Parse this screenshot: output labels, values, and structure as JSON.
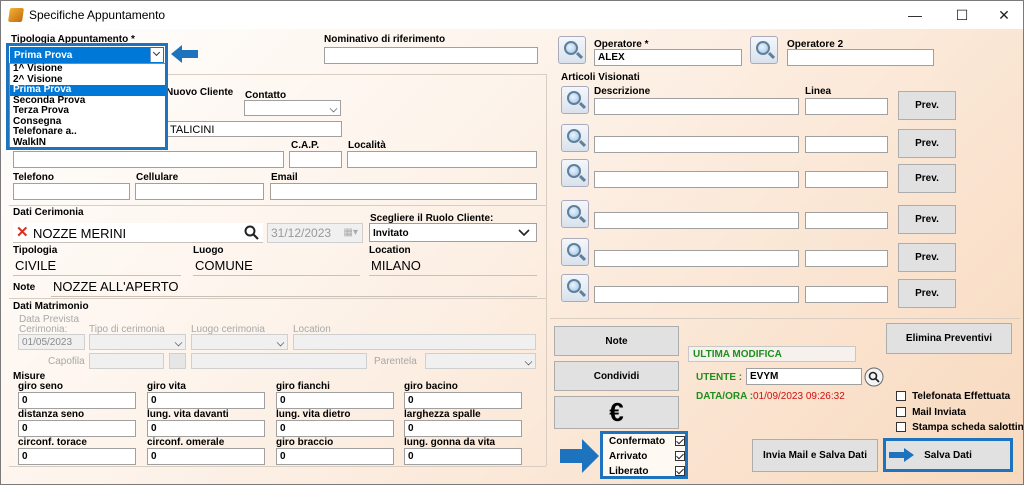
{
  "window": {
    "title": "Specifiche Appuntamento",
    "min": "—",
    "max": "☐",
    "close": "✕"
  },
  "tipologia": {
    "label": "Tipologia Appuntamento *",
    "value": "Prima Prova",
    "options": [
      "1^ Visione",
      "2^ Visione",
      "Prima Prova",
      "Seconda Prova",
      "Terza Prova",
      "Consegna",
      "Telefonare a..",
      "WalkIN"
    ]
  },
  "nominativo": {
    "label": "Nominativo di riferimento",
    "value": ""
  },
  "cliente": {
    "nuovo_label": "Nuovo Cliente",
    "contatto_label": "Contatto",
    "name_value": "TALICINI",
    "cap_label": "C.A.P.",
    "localita_label": "Località",
    "telefono_label": "Telefono",
    "cellulare_label": "Cellulare",
    "email_label": "Email"
  },
  "cerimonia": {
    "section_label": "Dati Cerimonia",
    "nome": "NOZZE MERINI",
    "data": "31/12/2023",
    "ruolo_label": "Scegliere il Ruolo Cliente:",
    "ruolo_value": "Invitato",
    "tipologia_label": "Tipologia",
    "tipologia_value": "CIVILE",
    "luogo_label": "Luogo",
    "luogo_value": "COMUNE",
    "location_label": "Location",
    "location_value": "MILANO",
    "note_label": "Note",
    "note_value": "NOZZE ALL'APERTO"
  },
  "matrimonio": {
    "section_label": "Dati Matrimonio",
    "data_prevista_label": "Data Prevista",
    "cerimonia_label": "Cerimonia:",
    "cerimonia_value": "01/05/2023",
    "tipo_label": "Tipo di cerimonia",
    "luogo_label": "Luogo cerimonia",
    "location_label": "Location",
    "capofila_label": "Capofila",
    "parentela_label": "Parentela"
  },
  "misure": {
    "section_label": "Misure",
    "fields": [
      {
        "label": "giro seno",
        "value": "0"
      },
      {
        "label": "giro vita",
        "value": "0"
      },
      {
        "label": "giro fianchi",
        "value": "0"
      },
      {
        "label": "giro bacino",
        "value": "0"
      },
      {
        "label": "distanza seno",
        "value": "0"
      },
      {
        "label": "lung. vita davanti",
        "value": "0"
      },
      {
        "label": "lung. vita dietro",
        "value": "0"
      },
      {
        "label": "larghezza spalle",
        "value": "0"
      },
      {
        "label": "circonf. torace",
        "value": "0"
      },
      {
        "label": "circonf. omerale",
        "value": "0"
      },
      {
        "label": "giro braccio",
        "value": "0"
      },
      {
        "label": "lung. gonna da vita",
        "value": "0"
      }
    ]
  },
  "operatori": {
    "op1_label": "Operatore *",
    "op1_value": "ALEX",
    "op2_label": "Operatore 2",
    "op2_value": ""
  },
  "articoli": {
    "section_label": "Articoli Visionati",
    "descrizione_label": "Descrizione",
    "linea_label": "Linea",
    "prev_label": "Prev."
  },
  "actions": {
    "note": "Note",
    "condividi": "Condividi",
    "euro": "€",
    "elimina": "Elimina Preventivi",
    "invia": "Invia Mail e Salva Dati",
    "salva": "Salva Dati"
  },
  "modifica": {
    "title": "ULTIMA MODIFICA",
    "utente_label": "UTENTE :",
    "utente_value": "EVYM",
    "data_label": "DATA/ORA :",
    "data_value": "01/09/2023 09:26:32"
  },
  "stato": {
    "confermato": "Confermato",
    "arrivato": "Arrivato",
    "liberato": "Liberato"
  },
  "extra": {
    "telefonata": "Telefonata Effettuata",
    "mail": "Mail Inviata",
    "stampa": "Stampa scheda salottino"
  },
  "colors": {
    "accent": "#1e73be",
    "modifica_green": "#1f8f1f",
    "modifica_red": "#d01010",
    "select_blue": "#0078d7"
  }
}
